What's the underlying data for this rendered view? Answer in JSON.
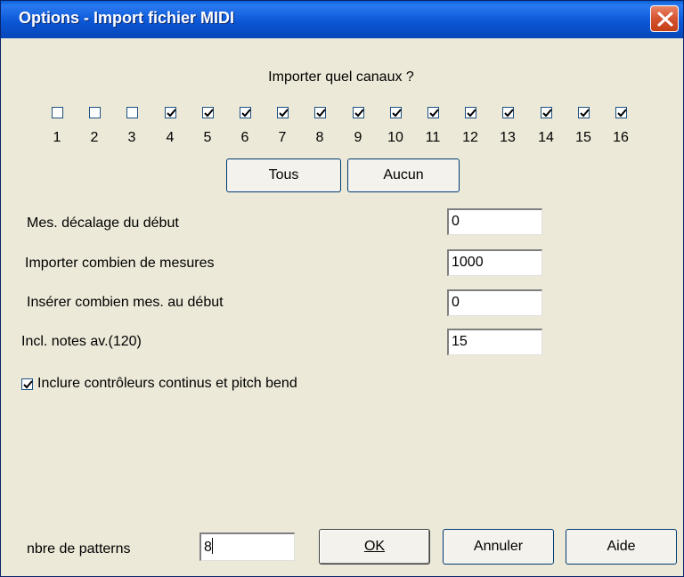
{
  "window": {
    "title": "Options - Import fichier MIDI"
  },
  "channels": {
    "heading": "Importer quel canaux ?",
    "items": [
      {
        "label": "1",
        "checked": false
      },
      {
        "label": "2",
        "checked": false
      },
      {
        "label": "3",
        "checked": false
      },
      {
        "label": "4",
        "checked": true
      },
      {
        "label": "5",
        "checked": true
      },
      {
        "label": "6",
        "checked": true
      },
      {
        "label": "7",
        "checked": true
      },
      {
        "label": "8",
        "checked": true
      },
      {
        "label": "9",
        "checked": true
      },
      {
        "label": "10",
        "checked": true
      },
      {
        "label": "11",
        "checked": true
      },
      {
        "label": "12",
        "checked": true
      },
      {
        "label": "13",
        "checked": true
      },
      {
        "label": "14",
        "checked": true
      },
      {
        "label": "15",
        "checked": true
      },
      {
        "label": "16",
        "checked": true
      }
    ],
    "all_label": "Tous",
    "none_label": "Aucun"
  },
  "fields": {
    "offset": {
      "label": "Mes. décalage du début",
      "value": "0"
    },
    "count": {
      "label": "Importer combien de mesures",
      "value": "1000"
    },
    "insert": {
      "label": "Insérer combien mes. au début",
      "value": "0"
    },
    "notes": {
      "label": "Incl. notes av.(120)",
      "value": "15"
    }
  },
  "controllers": {
    "label": "Inclure contrôleurs continus et pitch bend",
    "checked": true
  },
  "patterns": {
    "label": "nbre de patterns",
    "value": "8"
  },
  "buttons": {
    "ok": "OK",
    "cancel": "Annuler",
    "help": "Aide"
  },
  "colors": {
    "title_bar": "#0b57d6",
    "close_button": "#d5532f",
    "dialog_bg": "#ece9d8",
    "checkbox_border": "#1c5180"
  },
  "icons": {
    "close": "close-icon",
    "check": "checkmark-icon"
  }
}
